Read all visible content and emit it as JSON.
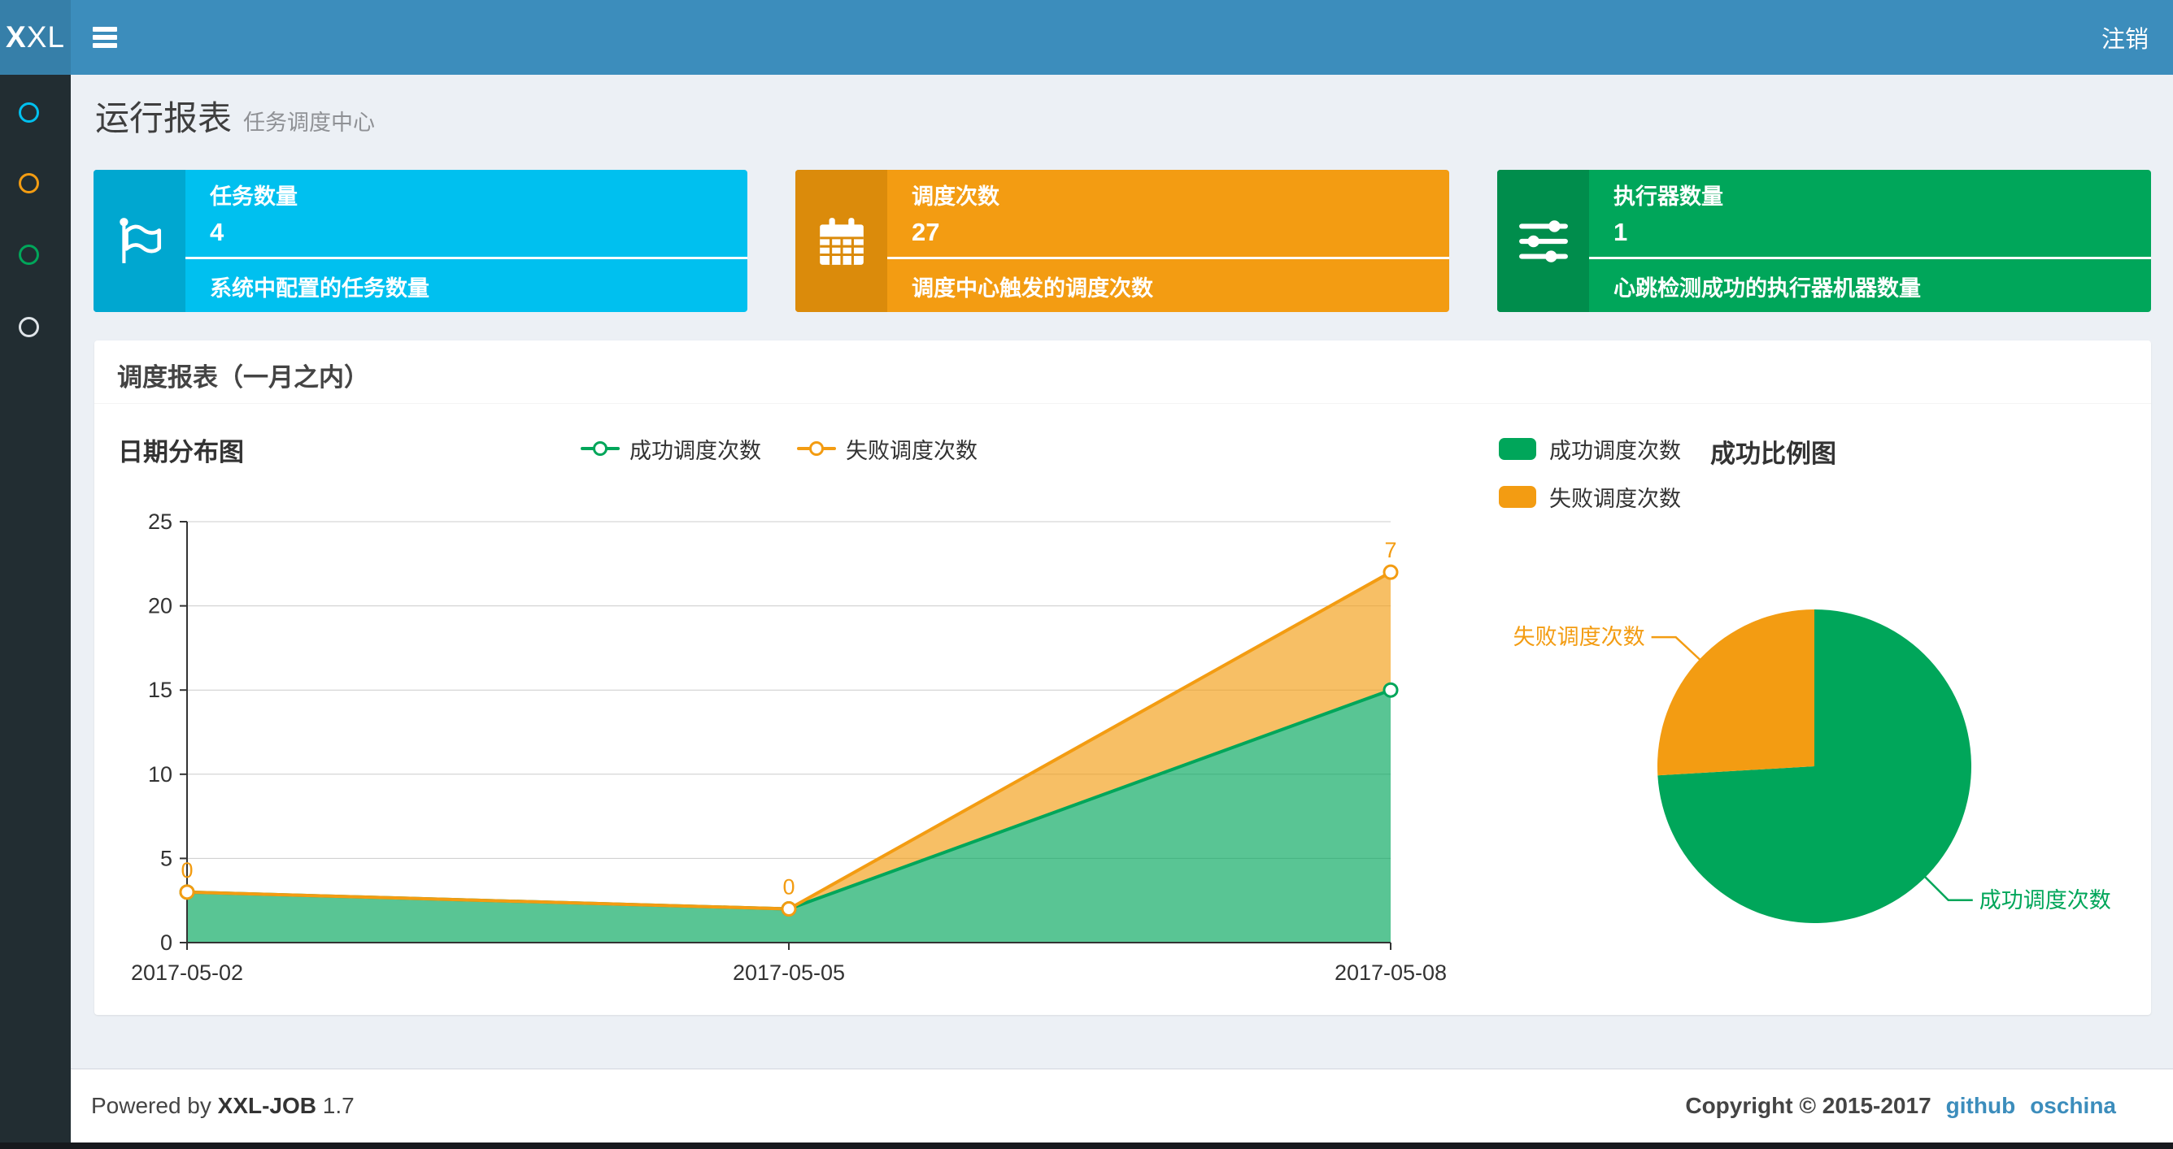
{
  "navbar": {
    "logo_bold": "X",
    "logo_rest": "XL",
    "logout": "注销"
  },
  "sidebar": {
    "items": [
      {
        "icon": "circle-icon",
        "color": "#00c0ef"
      },
      {
        "icon": "circle-icon",
        "color": "#f39c12"
      },
      {
        "icon": "circle-icon",
        "color": "#00a65a"
      },
      {
        "icon": "circle-icon",
        "color": "#dfe4e8"
      }
    ]
  },
  "header": {
    "title": "运行报表",
    "subtitle": "任务调度中心"
  },
  "cards": [
    {
      "title": "任务数量",
      "value": "4",
      "caption": "系统中配置的任务数量",
      "bg": "#00c0ef",
      "icon_bg": "#00a7d0",
      "icon": "flag-icon"
    },
    {
      "title": "调度次数",
      "value": "27",
      "caption": "调度中心触发的调度次数",
      "bg": "#f39c12",
      "icon_bg": "#db8b0b",
      "icon": "calendar-icon"
    },
    {
      "title": "执行器数量",
      "value": "1",
      "caption": "心跳检测成功的执行器机器数量",
      "bg": "#00a65a",
      "icon_bg": "#008d4c",
      "icon": "sliders-icon"
    }
  ],
  "panel": {
    "title": "调度报表（一月之内）"
  },
  "chart_data": [
    {
      "type": "area",
      "title": "日期分布图",
      "x": [
        "2017-05-02",
        "2017-05-05",
        "2017-05-08"
      ],
      "series": [
        {
          "name": "成功调度次数",
          "values": [
            3,
            2,
            15
          ],
          "color": "#00a65a",
          "fill": "rgba(0,166,90,0.65)"
        },
        {
          "name": "失败调度次数",
          "values": [
            0,
            0,
            7
          ],
          "color": "#f39c12",
          "fill": "rgba(243,156,18,0.65)",
          "point_labels": [
            "0",
            "0",
            "7"
          ]
        }
      ],
      "stacked": true,
      "ylim": [
        0,
        25
      ],
      "yticks": [
        0,
        5,
        10,
        15,
        20,
        25
      ],
      "grid": true,
      "legend_position": "top-center"
    },
    {
      "type": "pie",
      "title": "成功比例图",
      "slices": [
        {
          "label": "成功调度次数",
          "value": 20,
          "color": "#00a65a"
        },
        {
          "label": "失败调度次数",
          "value": 7,
          "color": "#f39c12"
        }
      ],
      "legend_position": "top-left"
    }
  ],
  "footer": {
    "powered_prefix": "Powered by ",
    "product": "XXL-JOB",
    "version": " 1.7",
    "copyright": "Copyright © 2015-2017",
    "links": [
      "github",
      "oschina"
    ]
  }
}
